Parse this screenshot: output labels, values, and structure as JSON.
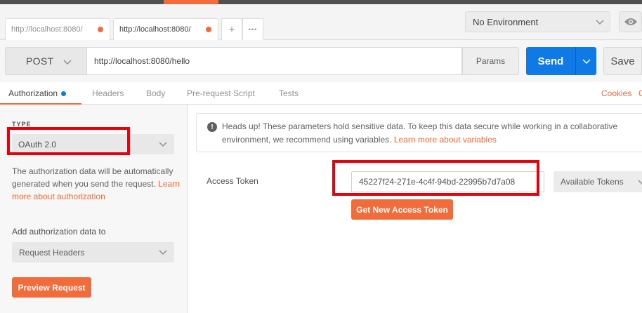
{
  "tabs": [
    {
      "label": "http://localhost:8080/",
      "unsaved": true
    },
    {
      "label": "http://localhost:8080/",
      "unsaved": true
    }
  ],
  "tab_add_label": "+",
  "tab_more_label": "•••",
  "environment": {
    "selected": "No Environment"
  },
  "request": {
    "method": "POST",
    "url": "http://localhost:8080/hello",
    "params_label": "Params",
    "send_label": "Send",
    "save_label": "Save"
  },
  "subtabs": {
    "authorization": "Authorization",
    "headers": "Headers",
    "body": "Body",
    "prerequest": "Pre-request Script",
    "tests": "Tests",
    "cookies": "Cookies",
    "code_initial": "C"
  },
  "auth": {
    "type_label": "TYPE",
    "type_value": "OAuth 2.0",
    "description": "The authorization data will be automatically generated when you send the request.",
    "learn_more": "Learn more about authorization",
    "add_to_label": "Add authorization data to",
    "add_to_value": "Request Headers",
    "preview_label": "Preview Request"
  },
  "alert": {
    "text": "Heads up! These parameters hold sensitive data. To keep this data secure while working in a collaborative environment, we recommend using variables.",
    "link": "Learn more about variables"
  },
  "token": {
    "label": "Access Token",
    "value": "45227f24-271e-4c4f-94bd-22995b7d7a08",
    "available_label": "Available Tokens",
    "get_new_label": "Get New Access Token"
  },
  "colors": {
    "accent": "#f26b3a",
    "send_blue": "#0f7ae5",
    "highlight_red": "#e8000b"
  }
}
